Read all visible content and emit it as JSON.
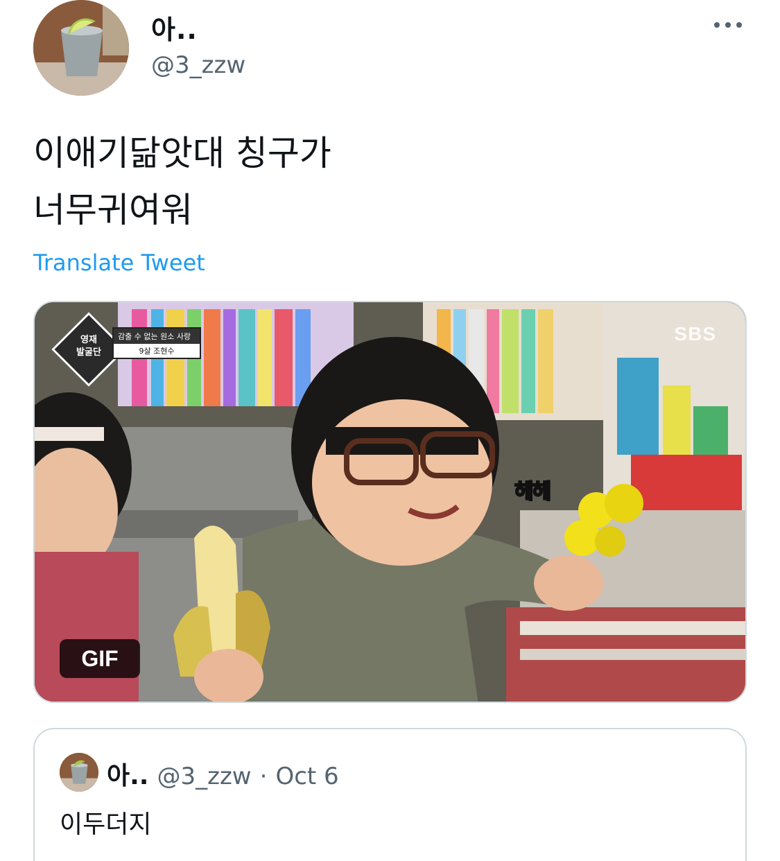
{
  "author": {
    "display_name": "아..",
    "handle": "@3_zzw",
    "avatar_icon": "cup-with-lime-avatar"
  },
  "tweet": {
    "text_lines": [
      "이애기닮앗대 칭구가",
      "너무귀여워"
    ],
    "translate_label": "Translate Tweet"
  },
  "media": {
    "gif_label": "GIF",
    "watermark": "SBS",
    "show_badge": "영재\n발굴단",
    "caption_line1": "감출 수 없는 원소 사랑",
    "caption_line2": "9살 조현수",
    "sfx": "헤헤"
  },
  "quote": {
    "display_name": "아..",
    "handle": "@3_zzw",
    "separator": "·",
    "date": "Oct 6",
    "text": "이두더지"
  },
  "colors": {
    "link": "#1d9bf0",
    "secondary_text": "#536471",
    "border": "#cfd9de"
  }
}
